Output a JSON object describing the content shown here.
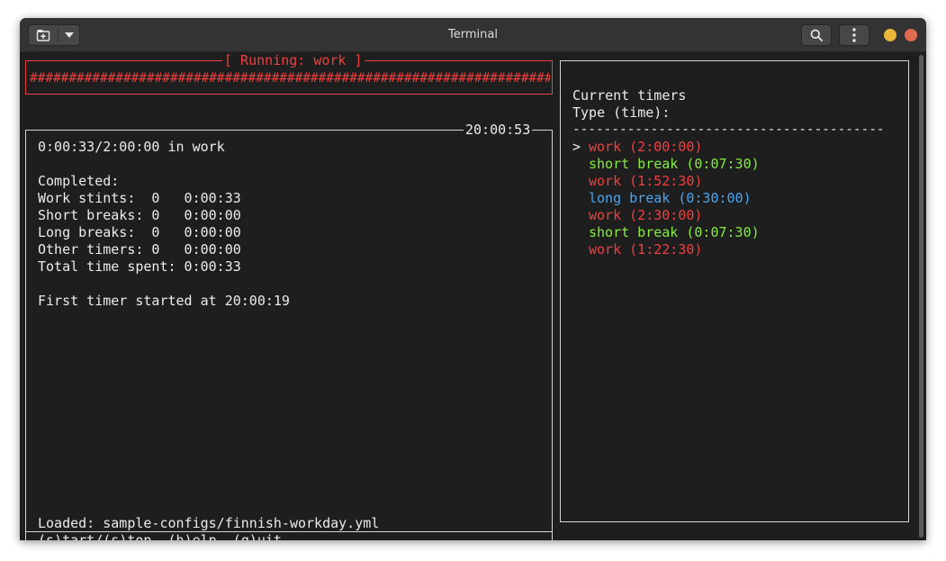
{
  "window": {
    "title": "Terminal"
  },
  "colors": {
    "work": "#ee4040",
    "short_break": "#86ec3f",
    "long_break": "#4aa5f0",
    "close": "#e06b4f",
    "minimize": "#e7b63a"
  },
  "titlebar": {
    "new_tab_icon": "new-tab-icon",
    "dropdown_icon": "chevron-down-icon",
    "search_icon": "search-icon",
    "menu_icon": "kebab-menu-icon"
  },
  "progress": {
    "label": "[ Running: work ]",
    "bar": "######################################################################"
  },
  "status": {
    "clock": "20:00:53",
    "elapsed": "0:00:33/2:00:00 in work",
    "completed_header": "Completed:",
    "rows": [
      "Work stints:  0   0:00:33",
      "Short breaks: 0   0:00:00",
      "Long breaks:  0   0:00:00",
      "Other timers: 0   0:00:00",
      "Total time spent: 0:00:33"
    ],
    "first_timer": "First timer started at 20:00:19",
    "loaded": "Loaded: sample-configs/finnish-workday.yml",
    "help": "(s)tart/(s)top, (h)elp, (q)uit"
  },
  "timers": {
    "header": "Current timers",
    "subheader": "Type (time):",
    "divider": "----------------------------------------",
    "cursor": ">",
    "items": [
      {
        "label": "work (2:00:00)",
        "kind": "work"
      },
      {
        "label": "short break (0:07:30)",
        "kind": "short"
      },
      {
        "label": "work (1:52:30)",
        "kind": "work"
      },
      {
        "label": "long break (0:30:00)",
        "kind": "long"
      },
      {
        "label": "work (2:30:00)",
        "kind": "work"
      },
      {
        "label": "short break (0:07:30)",
        "kind": "short"
      },
      {
        "label": "work (1:22:30)",
        "kind": "work"
      }
    ]
  }
}
